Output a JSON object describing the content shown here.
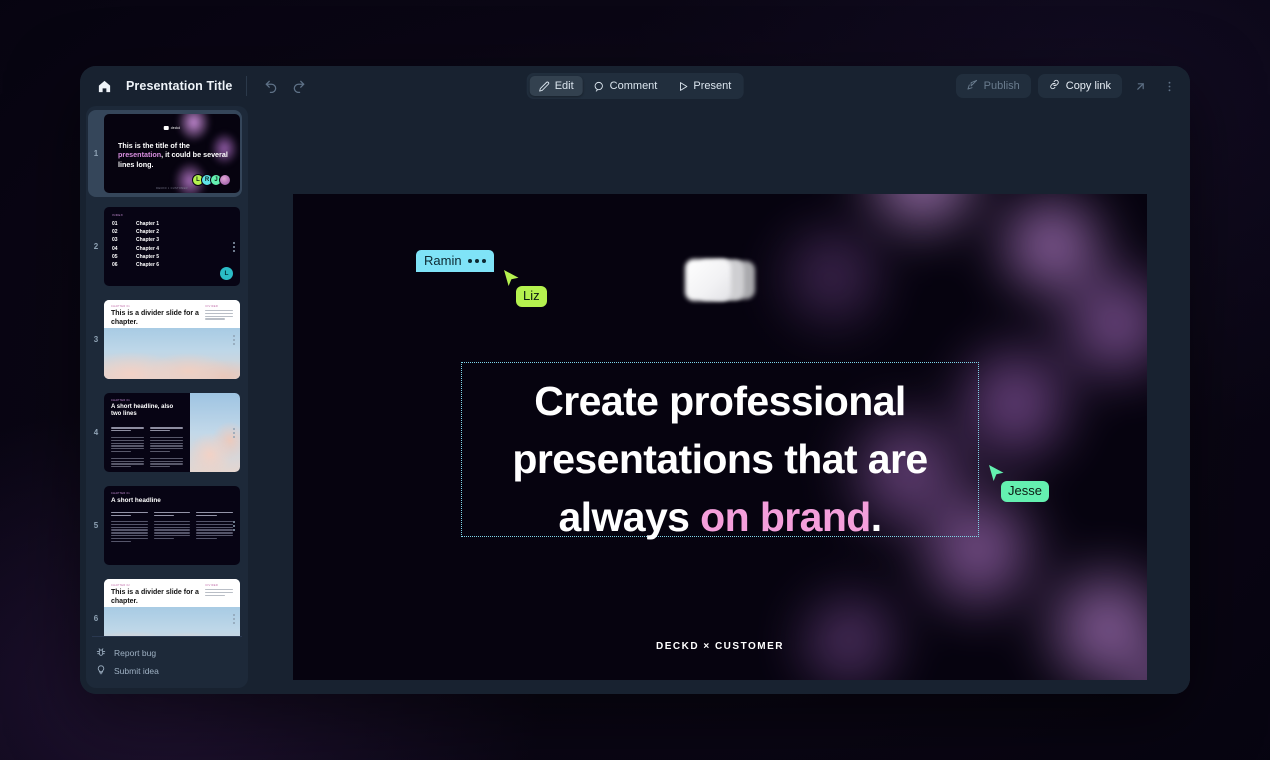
{
  "topbar": {
    "home_icon": "home-icon",
    "title": "Presentation Title",
    "undo_icon": "undo-icon",
    "redo_icon": "redo-icon",
    "modes": [
      {
        "label": "Edit",
        "icon": "pencil-icon",
        "active": true
      },
      {
        "label": "Comment",
        "icon": "comment-icon",
        "active": false
      },
      {
        "label": "Present",
        "icon": "play-icon",
        "active": false
      }
    ],
    "publish_label": "Publish",
    "publish_icon": "rocket-icon",
    "copy_link_label": "Copy link",
    "copy_link_icon": "link-icon",
    "share_icon": "arrow-up-right-icon",
    "more_icon": "kebab-menu-icon"
  },
  "sidebar": {
    "slides": [
      {
        "number": "1",
        "selected": true
      },
      {
        "number": "2",
        "selected": false
      },
      {
        "number": "3",
        "selected": false
      },
      {
        "number": "4",
        "selected": false
      },
      {
        "number": "5",
        "selected": false
      },
      {
        "number": "6",
        "selected": false
      }
    ],
    "slide1": {
      "brand": "deckd",
      "title_a": "This is the title of the ",
      "title_em": "presentation",
      "title_b": ", it could be several lines long.",
      "avatars": [
        {
          "initial": "L",
          "color": "#b5f24f"
        },
        {
          "initial": "R",
          "color": "#5fe3e8"
        },
        {
          "initial": "J",
          "color": "#64f0b0"
        },
        {
          "initial": "",
          "color": "#b070b8"
        }
      ],
      "footnote": "DECKD × CUSTOMER"
    },
    "slide2": {
      "eyebrow": "INDEX",
      "chapters": [
        {
          "num": "01",
          "name": "Chapter 1"
        },
        {
          "num": "02",
          "name": "Chapter 2"
        },
        {
          "num": "03",
          "name": "Chapter 3"
        },
        {
          "num": "04",
          "name": "Chapter 4"
        },
        {
          "num": "05",
          "name": "Chapter 5"
        },
        {
          "num": "06",
          "name": "Chapter 6"
        }
      ],
      "badge_initial": "L",
      "badge_color": "#2bbcc7"
    },
    "slide3": {
      "eyebrow": "CHAPTER 01",
      "headline": "This is a divider slide for a chapter.",
      "side_label": "DIVIDER"
    },
    "slide4": {
      "eyebrow": "CHAPTER 01",
      "headline": "A short headline, also two lines"
    },
    "slide5": {
      "eyebrow": "CHAPTER 01",
      "headline": "A short headline"
    },
    "slide6": {
      "eyebrow": "CHAPTER 02",
      "headline": "This is a divider slide for a chapter.",
      "side_label": "DIVIDER"
    },
    "footer": [
      {
        "label": "Report bug",
        "icon": "bug-icon"
      },
      {
        "label": "Submit idea",
        "icon": "lightbulb-icon"
      }
    ]
  },
  "canvas": {
    "logo_icon": "layered-cards-logo",
    "headline_a": "Create professional presentations that are always ",
    "headline_em": "on brand",
    "headline_b": ".",
    "footer": "DECKD × CUSTOMER",
    "selection_owner": "Ramin",
    "cursors": [
      {
        "name": "Liz",
        "color": "#b5f24f"
      },
      {
        "name": "Jesse",
        "color": "#64f0b0"
      }
    ]
  },
  "colors": {
    "accent_pink": "#f49fdb",
    "selection_cyan": "#7fe3f7",
    "app_chrome": "#182230",
    "sidebar": "#1d2939",
    "slide_bg": "#06030f"
  }
}
